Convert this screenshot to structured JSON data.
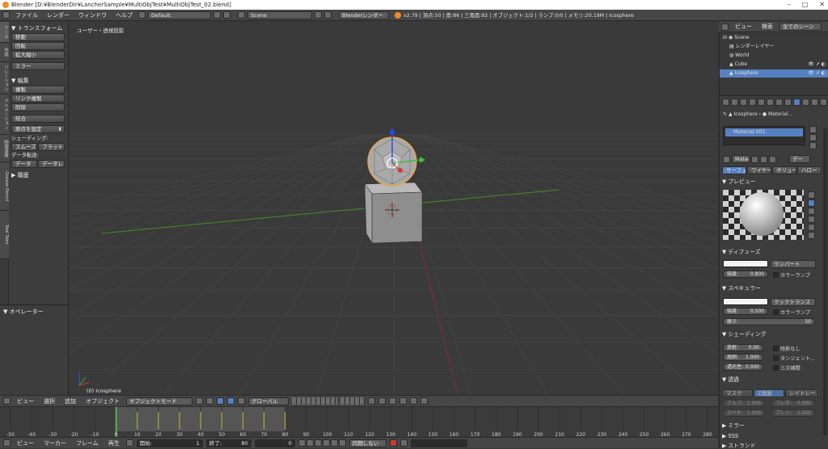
{
  "title": "Blender [D:¥BlenderDir¥LancherSample¥MultiObjTest¥MultiObjTest_02.blend]",
  "window_controls": [
    "–",
    "□",
    "✕"
  ],
  "menu": {
    "items": [
      "ファイル",
      "レンダー",
      "ウィンドウ",
      "ヘルプ"
    ],
    "screen_layout": "Default",
    "scene": "Scene",
    "render_engine": "Blenderレンダー",
    "stats": "v2.79 | 頂点:50 | 面:86 | 三角面:92 | オブジェクト:1/2 | ランプ:0/0 | メモリ:20.19M | Icosphere"
  },
  "tool_tabs": [
    "ツール",
    "作成",
    "リレーション",
    "アニメーション",
    "物理演算",
    "Grease Pencil",
    "Tool Tabs"
  ],
  "toolshelf": {
    "transform_header": "▼ トランスフォーム",
    "transform_buttons": [
      "移動",
      "回転",
      "拡大縮小"
    ],
    "mirror": "ミラー",
    "edit_header": "▼ 編集",
    "edit_buttons": [
      "複製",
      "リンク複製",
      "削除",
      "結合"
    ],
    "origin": "原点を設定",
    "shading_label": "シェーディング:",
    "smooth": "スムーズ",
    "flat": "フラット",
    "datatransfer_label": "データ転送:",
    "data": "データ",
    "datalayer": "データレ",
    "history_header": "▶ 履歴"
  },
  "operator_header": "▼ オペレーター",
  "viewport": {
    "view_label": "ユーザー・透視投影",
    "object_label": "(0) Icosphere"
  },
  "viewport_header": {
    "menus": [
      "ビュー",
      "選択",
      "追加",
      "オブジェクト"
    ],
    "mode": "オブジェクトモード",
    "orientation": "グローバル"
  },
  "timeline": {
    "ticks": [
      -50,
      -40,
      -30,
      -20,
      -10,
      0,
      10,
      20,
      30,
      40,
      50,
      60,
      70,
      80,
      90,
      100,
      110,
      120,
      130,
      140,
      150,
      160,
      170,
      180,
      190,
      200,
      210,
      220,
      230,
      240,
      250,
      260,
      270,
      280
    ],
    "range_start": 0,
    "range_end": 80,
    "current_frame": 0
  },
  "timeline_header": {
    "menus": [
      "ビュー",
      "マーカー",
      "フレーム",
      "再生"
    ],
    "start_label": "開始:",
    "start": "1",
    "end_label": "終了:",
    "end": "80",
    "current": "0",
    "sync": "同期しない"
  },
  "outliner": {
    "header": [
      "ビュー",
      "検索",
      "全てのシーン"
    ],
    "items": [
      {
        "name": "Scene",
        "level": 0
      },
      {
        "name": "レンダーレイヤー",
        "level": 1
      },
      {
        "name": "World",
        "level": 1
      },
      {
        "name": "Cube",
        "level": 1
      },
      {
        "name": "Icosphere",
        "level": 1
      }
    ]
  },
  "properties": {
    "breadcrumb": [
      "Icosphere",
      "Material..."
    ],
    "material_slot": "Material.001",
    "material_name": "Materia",
    "data_btn": "デー",
    "tabs": [
      "サーフェ",
      "ワイヤー",
      "ボリュー",
      "ハロー"
    ],
    "preview_header": "▼ プレビュー",
    "diffuse_header": "▼ ディフューズ",
    "diffuse_shader": "ランバート",
    "diffuse_intensity_label": "強度:",
    "diffuse_intensity": "0.800",
    "ramp": "カラーランプ",
    "specular_header": "▼ スペキュラー",
    "specular_shader": "クックトランス",
    "specular_intensity_label": "強度:",
    "specular_intensity": "0.500",
    "hardness_label": "硬さ:",
    "hardness": "50",
    "shading_header": "▼ シェーディング",
    "emit_label": "放射:",
    "emit": "0.00",
    "ambient_label": "周囲:",
    "ambient": "1.000",
    "translucency_label": "透光性:",
    "translucency": "0.000",
    "shadeless": "陰影なし",
    "tangent": "タンジェント...",
    "cubic": "三次補間",
    "transparency_header": "▼ 透過",
    "trans_tabs": [
      "マスク",
      "Z透過",
      "レイトレース"
    ],
    "alpha_label": "アルフ:",
    "alpha": "1.000",
    "fresnel_label": "フレネ:",
    "fresnel": "0.000",
    "specular_alpha_label": "スペキ:",
    "specular_alpha": "1.000",
    "blend_label": "ブレン:",
    "blend": "1.250",
    "mirror_header": "▶ ミラー",
    "sss_header": "▶ SSS",
    "strand_header": "▶ ストランド"
  },
  "colors": {
    "accent": "#5680c2",
    "x_axis": "#8b2d2d",
    "y_axis": "#4a8a2a",
    "playhead": "#56b04a"
  }
}
